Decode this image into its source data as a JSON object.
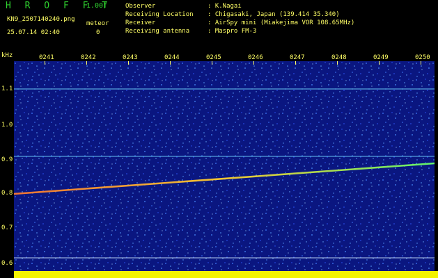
{
  "header": {
    "logo": "H R O F F T",
    "version": "1.00f",
    "filename": "KN9_2507140240.png",
    "meteor_label": "meteor",
    "datetime": "25.07.14 02:40",
    "count": "0",
    "fields": [
      {
        "label": "Observer",
        "value": ": K.Nagai"
      },
      {
        "label": "Receiving Location",
        "value": ": Chigasaki, Japan (139.414 35.340)"
      },
      {
        "label": "Receiver",
        "value": ": AirSpy mini (Miakejima VOR 108.65MHz)"
      },
      {
        "label": "Receiving antenna",
        "value": ": Maspro FM-3"
      }
    ]
  },
  "axes": {
    "y_unit": "kHz",
    "y_ticks": [
      "1.1",
      "1.0",
      "0.9",
      "0.8",
      "0.7",
      "0.6"
    ],
    "x_ticks": [
      "0241",
      "0242",
      "0243",
      "0244",
      "0245",
      "0246",
      "0247",
      "0248",
      "0249",
      "0250"
    ]
  },
  "colors": {
    "background": "#0a1680",
    "noise": "#3e7bff",
    "trace": "#ffcf2f",
    "header_text": "#ffff66",
    "logo": "#2fd12f",
    "baseline": "#f3f300"
  }
}
